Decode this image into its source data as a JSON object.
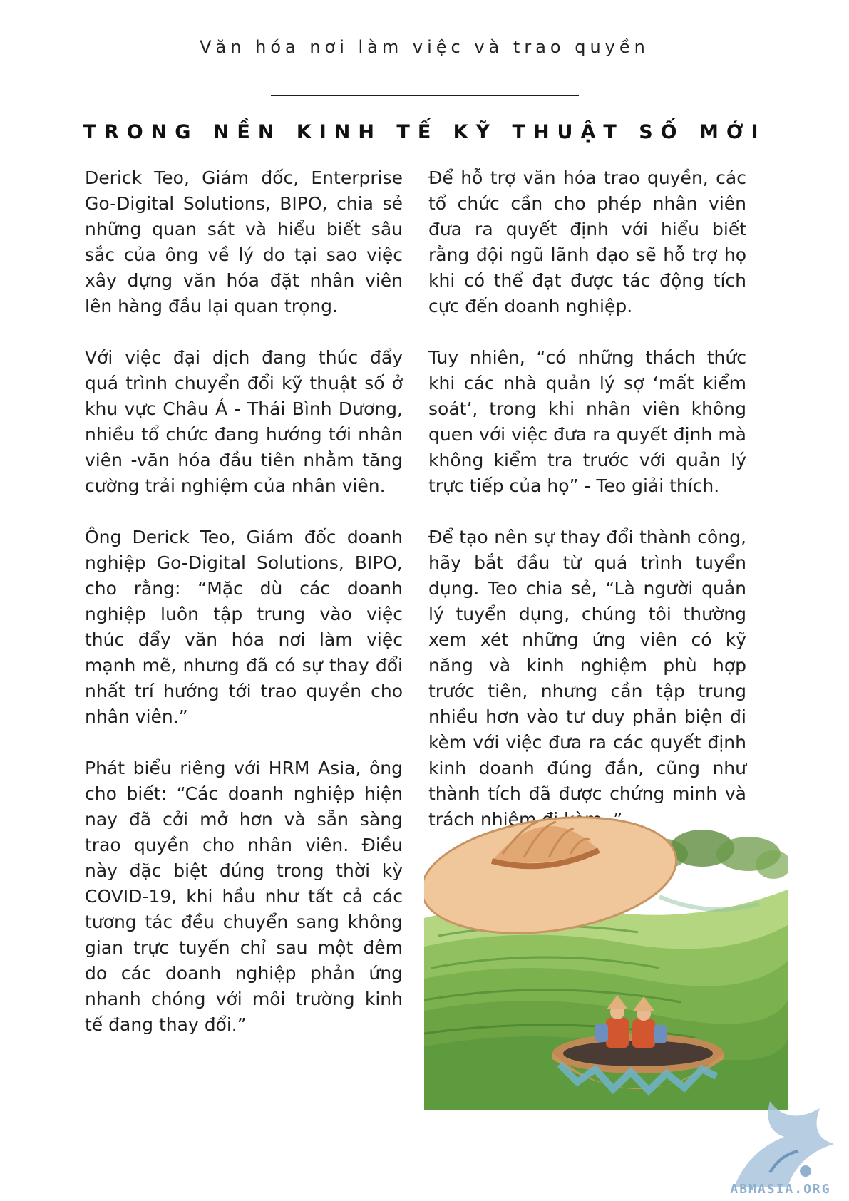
{
  "header": {
    "kicker": "Văn hóa nơi làm việc và trao quyền",
    "title": "TRONG NỀN KINH TẾ KỸ THUẬT SỐ MỚI"
  },
  "left_column": {
    "paragraphs": [
      "Derick Teo, Giám đốc, Enterprise Go-Digital Solutions, BIPO, chia sẻ những quan sát và hiểu biết sâu sắc của ông về lý do tại sao việc xây dựng văn hóa đặt nhân viên lên hàng đầu lại quan trọng.",
      "Với việc đại dịch đang thúc đẩy quá trình chuyển đổi kỹ thuật số ở khu vực Châu Á - Thái Bình Dương, nhiều tổ chức đang hướng tới nhân viên -văn hóa đầu tiên nhằm tăng cường trải nghiệm của nhân viên.",
      "Ông Derick Teo, Giám đốc doanh nghiệp Go-Digital Solutions, BIPO, cho rằng: “Mặc dù các doanh nghiệp luôn tập trung vào việc thúc đẩy văn hóa nơi làm việc mạnh mẽ, nhưng đã có sự thay đổi nhất trí hướng tới trao quyền cho nhân viên.”",
      "Phát biểu riêng với HRM Asia, ông cho biết: “Các doanh nghiệp hiện nay đã cởi mở hơn và sẵn sàng trao quyền cho nhân viên. Điều này đặc biệt đúng trong thời kỳ COVID-19, khi hầu như tất cả các tương tác đều chuyển sang không gian trực tuyến chỉ sau một đêm do các doanh nghiệp phản ứng nhanh chóng với môi trường kinh tế đang thay đổi.”"
    ]
  },
  "right_column": {
    "paragraphs": [
      "Để hỗ trợ văn hóa trao quyền, các tổ chức cần cho phép nhân viên đưa ra quyết định với hiểu biết rằng đội ngũ lãnh đạo sẽ hỗ trợ họ khi có thể đạt được tác động tích cực đến doanh nghiệp.",
      "Tuy nhiên, “có những thách thức khi các nhà quản lý sợ ‘mất kiểm soát’, trong khi nhân viên không quen với việc đưa ra quyết định mà không kiểm tra trước với quản lý trực tiếp của họ” - Teo giải thích.",
      "Để tạo nên sự thay đổi thành công, hãy bắt đầu từ quá trình tuyển dụng. Teo chia sẻ, “Là người quản lý tuyển dụng, chúng tôi thường xem xét những ứng viên có kỹ năng và kinh nghiệm phù hợp trước tiên, nhưng cần tập trung nhiều hơn vào tư duy phản biện đi kèm với việc đưa ra các quyết định kinh doanh đúng đắn, cũng như thành tích đã được chứng minh và trách nhiệm đi kèm. ”"
    ]
  },
  "watermark": {
    "text": "ABMASIA.ORG"
  },
  "colors": {
    "text": "#1f1f1f",
    "hat": "#e8b88a",
    "rice_field": "#8cbf5a",
    "basket": "#b07a44",
    "watermark": "#8fb0cf"
  }
}
